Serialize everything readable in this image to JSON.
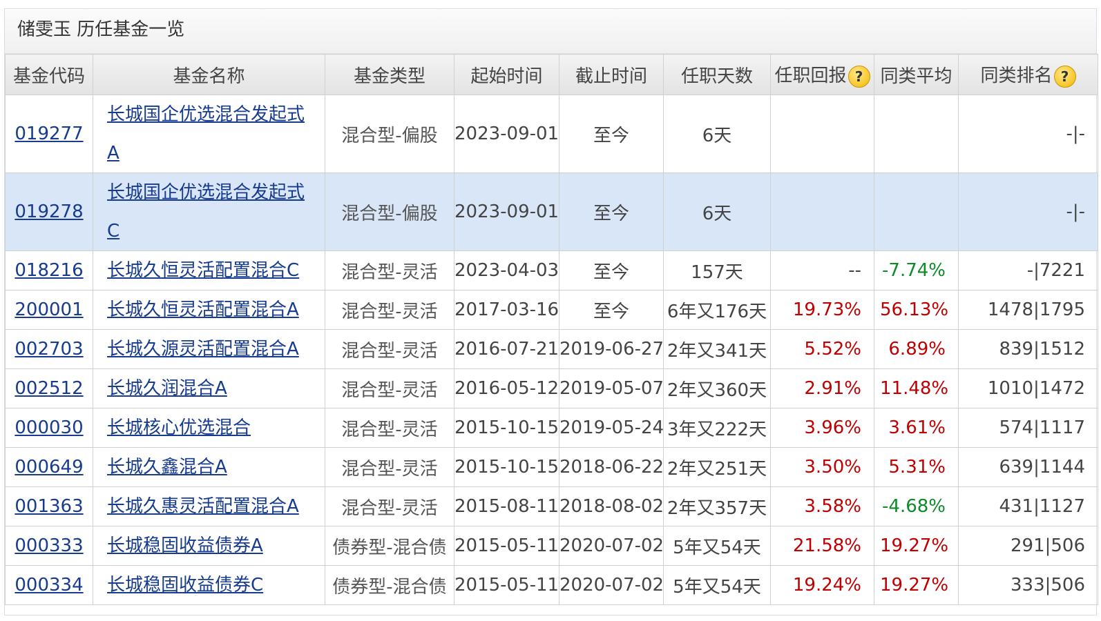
{
  "title": "储雯玉 历任基金一览",
  "headers": {
    "code": "基金代码",
    "name": "基金名称",
    "type": "基金类型",
    "start": "起始时间",
    "end": "截止时间",
    "days": "任职天数",
    "ret": "任职回报",
    "avg": "同类平均",
    "rank": "同类排名"
  },
  "help_icon": "?",
  "colors": {
    "link": "#163b8f",
    "positive": "#c00000",
    "negative": "#0d8a2a",
    "selected_row": "#d9e6f8"
  },
  "rows": [
    {
      "code": "019277",
      "name": "长城国企优选混合发起式A",
      "type": "混合型-偏股",
      "start": "2023-09-01",
      "end": "至今",
      "days": "6天",
      "ret": "",
      "avg": "",
      "rank": "-|-"
    },
    {
      "code": "019278",
      "name": "长城国企优选混合发起式C",
      "type": "混合型-偏股",
      "start": "2023-09-01",
      "end": "至今",
      "days": "6天",
      "ret": "",
      "avg": "",
      "rank": "-|-"
    },
    {
      "code": "018216",
      "name": "长城久恒灵活配置混合C",
      "type": "混合型-灵活",
      "start": "2023-04-03",
      "end": "至今",
      "days": "157天",
      "ret": "--",
      "avg": "-7.74%",
      "rank": "-|7221"
    },
    {
      "code": "200001",
      "name": "长城久恒灵活配置混合A",
      "type": "混合型-灵活",
      "start": "2017-03-16",
      "end": "至今",
      "days": "6年又176天",
      "ret": "19.73%",
      "avg": "56.13%",
      "rank": "1478|1795"
    },
    {
      "code": "002703",
      "name": "长城久源灵活配置混合A",
      "type": "混合型-灵活",
      "start": "2016-07-21",
      "end": "2019-06-27",
      "days": "2年又341天",
      "ret": "5.52%",
      "avg": "6.89%",
      "rank": "839|1512"
    },
    {
      "code": "002512",
      "name": "长城久润混合A",
      "type": "混合型-灵活",
      "start": "2016-05-12",
      "end": "2019-05-07",
      "days": "2年又360天",
      "ret": "2.91%",
      "avg": "11.48%",
      "rank": "1010|1472"
    },
    {
      "code": "000030",
      "name": "长城核心优选混合",
      "type": "混合型-灵活",
      "start": "2015-10-15",
      "end": "2019-05-24",
      "days": "3年又222天",
      "ret": "3.96%",
      "avg": "3.61%",
      "rank": "574|1117"
    },
    {
      "code": "000649",
      "name": "长城久鑫混合A",
      "type": "混合型-灵活",
      "start": "2015-10-15",
      "end": "2018-06-22",
      "days": "2年又251天",
      "ret": "3.50%",
      "avg": "5.31%",
      "rank": "639|1144"
    },
    {
      "code": "001363",
      "name": "长城久惠灵活配置混合A",
      "type": "混合型-灵活",
      "start": "2015-08-11",
      "end": "2018-08-02",
      "days": "2年又357天",
      "ret": "3.58%",
      "avg": "-4.68%",
      "rank": "431|1127"
    },
    {
      "code": "000333",
      "name": "长城稳固收益债券A",
      "type": "债券型-混合债",
      "start": "2015-05-11",
      "end": "2020-07-02",
      "days": "5年又54天",
      "ret": "21.58%",
      "avg": "19.27%",
      "rank": "291|506"
    },
    {
      "code": "000334",
      "name": "长城稳固收益债券C",
      "type": "债券型-混合债",
      "start": "2015-05-11",
      "end": "2020-07-02",
      "days": "5年又54天",
      "ret": "19.24%",
      "avg": "19.27%",
      "rank": "333|506"
    }
  ]
}
